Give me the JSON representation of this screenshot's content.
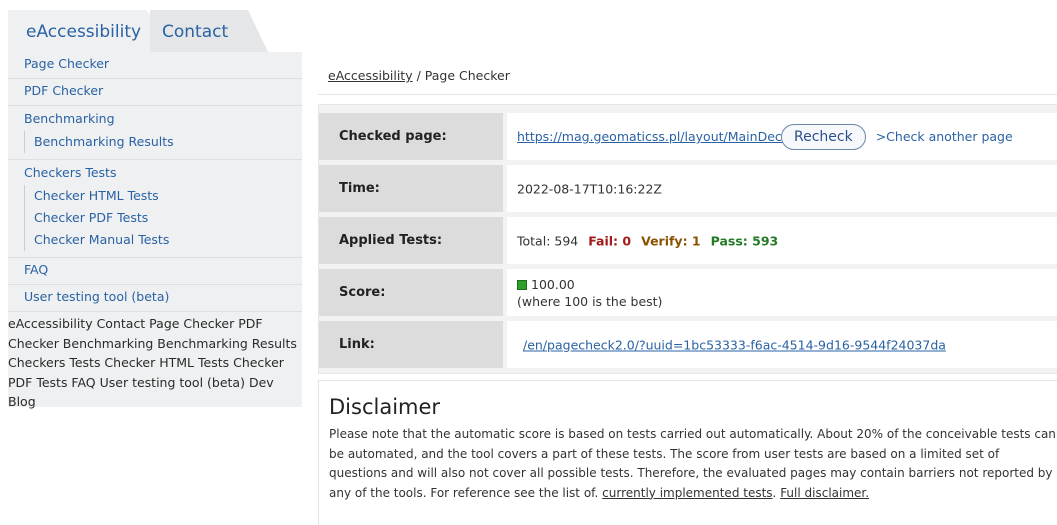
{
  "tabs": [
    {
      "label": "eAccessibility"
    },
    {
      "label": "Contact"
    }
  ],
  "sidebar": {
    "page_checker": "Page Checker",
    "pdf_checker": "PDF Checker",
    "benchmarking": "Benchmarking",
    "benchmarking_results": "Benchmarking Results",
    "checkers_tests": "Checkers Tests",
    "checker_html": "Checker HTML Tests",
    "checker_pdf": "Checker PDF Tests",
    "checker_manual": "Checker Manual Tests",
    "faq": "FAQ",
    "user_testing": "User testing tool (beta)",
    "plain_text": "eAccessibility Contact Page Checker PDF Checker Benchmarking Benchmarking Results Checkers Tests Checker HTML Tests Checker PDF Tests FAQ User testing tool (beta) Dev Blog"
  },
  "breadcrumb": {
    "root": "eAccessibility",
    "separator": " / ",
    "current": "Page Checker"
  },
  "results": {
    "checked_page_label": "Checked page:",
    "checked_page_url": "https://mag.geomaticss.pl/layout/MainDeclaration",
    "recheck_label": "Recheck",
    "another_label": ">Check another page",
    "time_label": "Time:",
    "time_value": "2022-08-17T10:16:22Z",
    "applied_label": "Applied Tests:",
    "total": "Total: 594",
    "fail": "Fail: 0",
    "verify": "Verify: 1",
    "pass": "Pass: 593",
    "score_label": "Score:",
    "score_value": "100.00",
    "score_note": "(where 100 is the best)",
    "link_label": "Link:",
    "link_value": "/en/pagecheck2.0/?uuid=1bc53333-f6ac-4514-9d16-9544f24037da"
  },
  "disclaimer": {
    "title": "Disclaimer",
    "text": "Please note that the automatic score is based on tests carried out automatically. About 20% of the conceivable tests can be automated, and the tool covers a part of these tests. The score from user tests are based on a limited set of questions and will also not cover all possible tests. Therefore, the evaluated pages may contain barriers not reported by any of the tools. For reference see the list of. ",
    "tests_link": "currently implemented tests",
    "sep": ". ",
    "full_link": "Full disclaimer."
  },
  "colors": {
    "link": "#2a62a4",
    "fail": "#a11b1b",
    "verify": "#8a5200",
    "pass": "#257a25",
    "score_indicator": "#2ca02c"
  }
}
